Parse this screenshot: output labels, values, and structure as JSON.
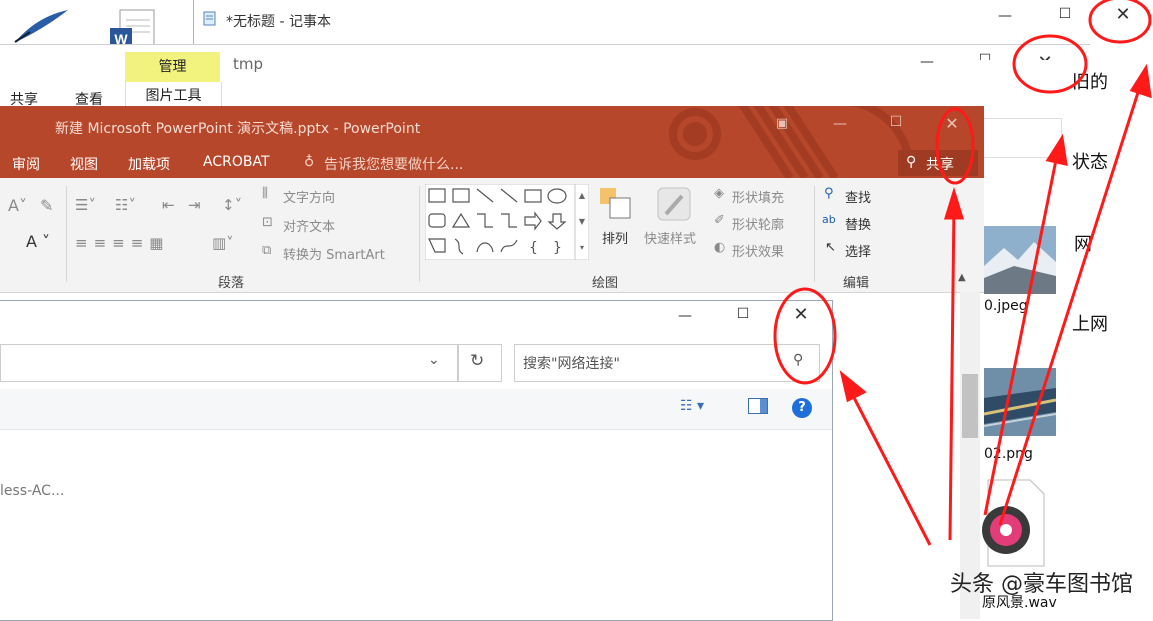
{
  "notepad": {
    "title": "*无标题 - 记事本"
  },
  "explorer_back": {
    "tabs": {
      "share": "共享",
      "view": "查看"
    },
    "context_tab": "管理",
    "context_group": "图片工具",
    "title": "tmp"
  },
  "right_panel": {
    "frag1": "旧的",
    "frag2": "状态",
    "frag3": "网",
    "frag4": "上网",
    "file1": "0.jpeg",
    "file2": "02.png",
    "file3": "原风景.wav"
  },
  "powerpoint": {
    "title": "新建 Microsoft PowerPoint 演示文稿.pptx - PowerPoint",
    "tabs": [
      "审阅",
      "视图",
      "加载项",
      "ACROBAT"
    ],
    "tell_me": "告诉我您想要做什么...",
    "share": "共享",
    "ribbon": {
      "text_direction": "文字方向",
      "align_text": "对齐文本",
      "convert_smartart": "转换为 SmartArt",
      "paragraph_group": "段落",
      "arrange": "排列",
      "quick_styles": "快速样式",
      "shape_fill": "形状填充",
      "shape_outline": "形状轮廓",
      "shape_effects": "形状效果",
      "drawing_group": "绘图",
      "find": "查找",
      "replace": "替换",
      "select": "选择",
      "editing_group": "编辑"
    }
  },
  "network_window": {
    "search_placeholder": "搜索\"网络连接\"",
    "item_fragment": "less-AC..."
  },
  "watermark": "头条 @豪车图书馆",
  "colors": {
    "ppt_accent": "#b7472a",
    "annotation": "#ff1a1a",
    "manage_tab": "#f2f27f"
  }
}
